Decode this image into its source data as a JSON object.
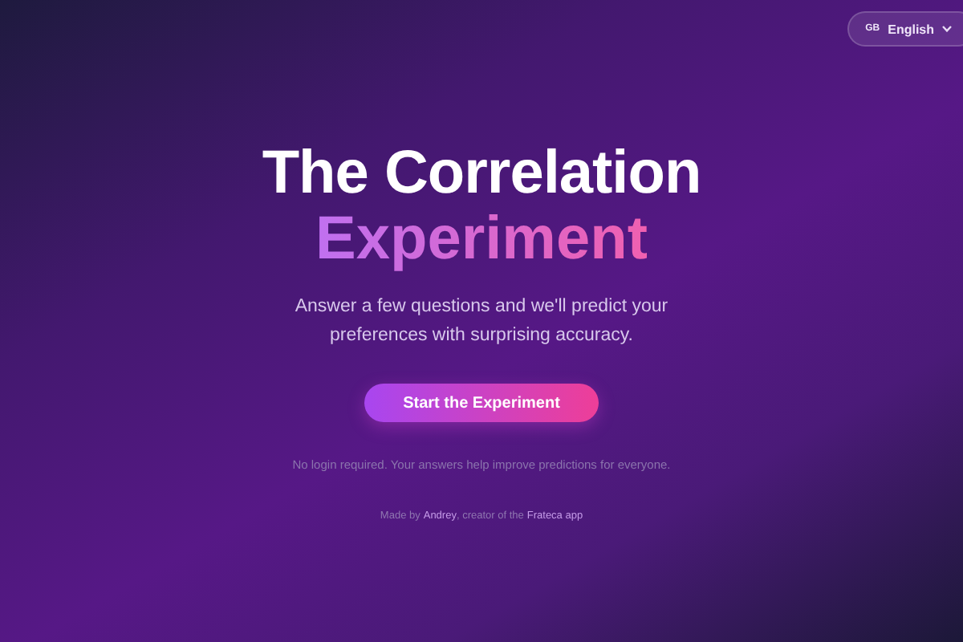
{
  "language_button": {
    "flag": "GB",
    "label": "English"
  },
  "title": {
    "line_1": "The Correlation",
    "line_2": "Experiment"
  },
  "subtitle": "Answer a few questions and we'll predict your preferences with surprising accuracy.",
  "start_button": "Start the Experiment",
  "note": "No login required. Your answers help improve predictions for everyone.",
  "footer": {
    "before": "Made by",
    "author_link": "Andrey",
    "middle": ", creator of the",
    "app_link": "Frateca app"
  }
}
